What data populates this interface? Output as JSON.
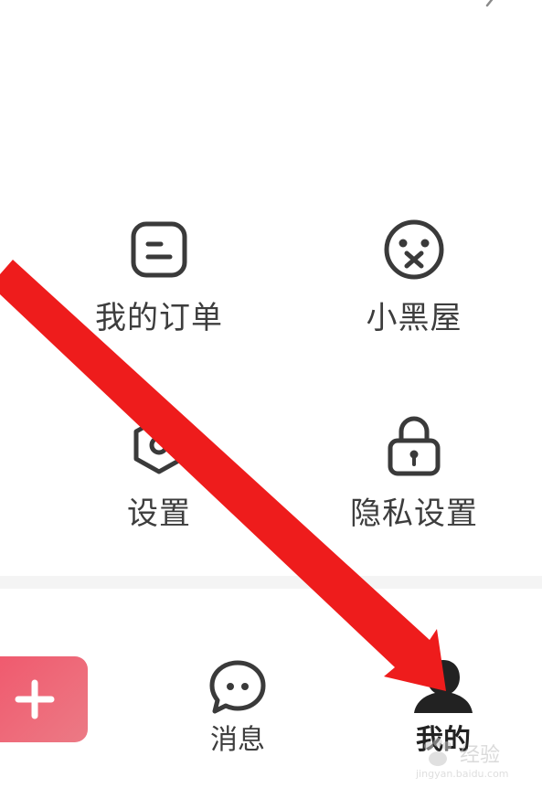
{
  "menu": {
    "items": [
      {
        "label": "我的订单",
        "icon": "order-list-icon"
      },
      {
        "label": "小黑屋",
        "icon": "dizzy-face-icon"
      },
      {
        "label": "设置",
        "icon": "hex-gear-icon"
      },
      {
        "label": "隐私设置",
        "icon": "padlock-icon"
      }
    ]
  },
  "tabbar": {
    "publish_icon": "plus-icon",
    "tabs": [
      {
        "label": "消息",
        "icon": "chat-bubble-icon"
      },
      {
        "label": "我的",
        "icon": "user-avatar-icon",
        "active": true
      }
    ]
  },
  "watermark": {
    "text": "经验",
    "sub": "jingyan.baidu.com"
  },
  "colors": {
    "icon_stroke": "#3a3a3a",
    "publish_gradient_start": "#f0576c",
    "publish_gradient_end": "#ec7a85",
    "annotation_arrow": "#ee1c1c",
    "divider": "#f4f4f4"
  }
}
